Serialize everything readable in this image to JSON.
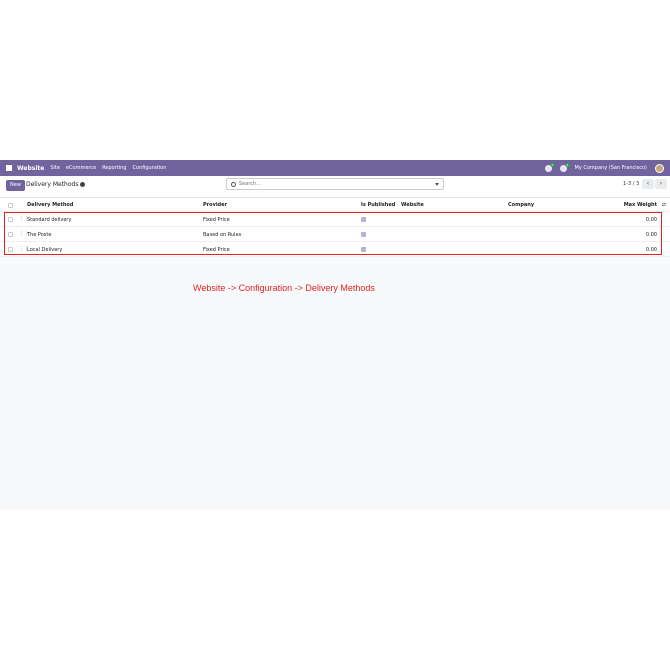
{
  "navbar": {
    "brand": "Website",
    "menu": [
      "Site",
      "eCommerce",
      "Reporting",
      "Configuration"
    ],
    "chat_badge": "5",
    "activity_badge": "4",
    "company": "My Company (San Francisco)"
  },
  "control": {
    "new_label": "New",
    "breadcrumb": "Delivery Methods",
    "search_placeholder": "Search...",
    "pager": "1-3 / 3"
  },
  "table": {
    "headers": [
      "Delivery Method",
      "Provider",
      "Is Published",
      "Website",
      "Company",
      "Max Weight"
    ],
    "rows": [
      {
        "name": "Standard delivery",
        "provider": "Fixed Price",
        "published": true,
        "max_weight": "0.00"
      },
      {
        "name": "The Poste",
        "provider": "Based on Rules",
        "published": true,
        "max_weight": "0.00"
      },
      {
        "name": "Local Delivery",
        "provider": "Fixed Price",
        "published": true,
        "max_weight": "0.00"
      }
    ]
  },
  "caption": "Website -> Configuration -> Delivery Methods",
  "colors": {
    "navbar": "#71639e",
    "annotation": "#e02424"
  }
}
